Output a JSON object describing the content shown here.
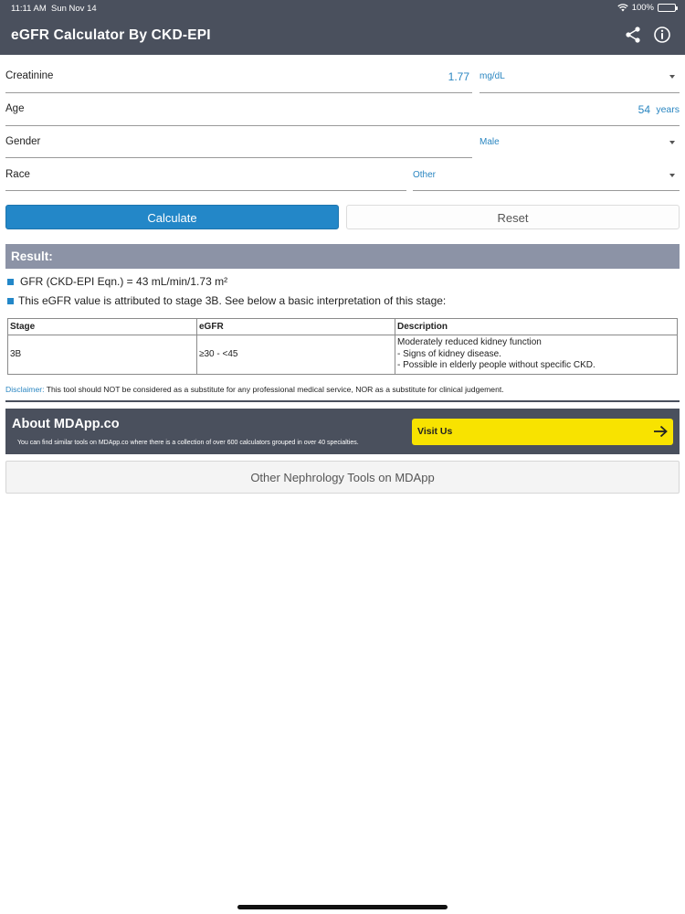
{
  "status": {
    "time": "11:11 AM",
    "date": "Sun Nov 14",
    "battery": "100%"
  },
  "header": {
    "title": "eGFR Calculator By CKD-EPI",
    "share_icon": "share-icon",
    "info_icon": "info-icon"
  },
  "form": {
    "creatinine": {
      "label": "Creatinine",
      "value": "1.77",
      "unit": "mg/dL"
    },
    "age": {
      "label": "Age",
      "value": "54",
      "unit": "years"
    },
    "gender": {
      "label": "Gender",
      "value": "Male"
    },
    "race": {
      "label": "Race",
      "value": "Other"
    }
  },
  "buttons": {
    "calculate": "Calculate",
    "reset": "Reset"
  },
  "result": {
    "title": "Result:",
    "gfr_line": "GFR (CKD-EPI Eqn.) = 43 mL/min/1.73 m²",
    "stage_line": "This eGFR value is attributed to stage 3B. See below a basic interpretation of this stage:",
    "table": {
      "headers": [
        "Stage",
        "eGFR",
        "Description"
      ],
      "row": {
        "stage": "3B",
        "egfr": "≥30 - <45",
        "description": [
          "Moderately reduced kidney function",
          "- Signs of kidney disease.",
          "- Possible in elderly people without specific CKD."
        ]
      }
    }
  },
  "disclaimer": {
    "label": "Disclaimer:",
    "text": " This tool should NOT be considered as a substitute for any professional medical service, NOR as a substitute for clinical judgement."
  },
  "about": {
    "title": "About MDApp.co",
    "text": "You can find similar tools on MDApp.co where there is a collection of over 600 calculators grouped in over 40 specialties.",
    "visit_label": "Visit Us"
  },
  "other_tools": "Other Nephrology Tools on MDApp",
  "colors": {
    "header": "#4a505d",
    "accent": "#2387c8",
    "result_bar": "#8c93a6",
    "visit": "#f8e300"
  }
}
